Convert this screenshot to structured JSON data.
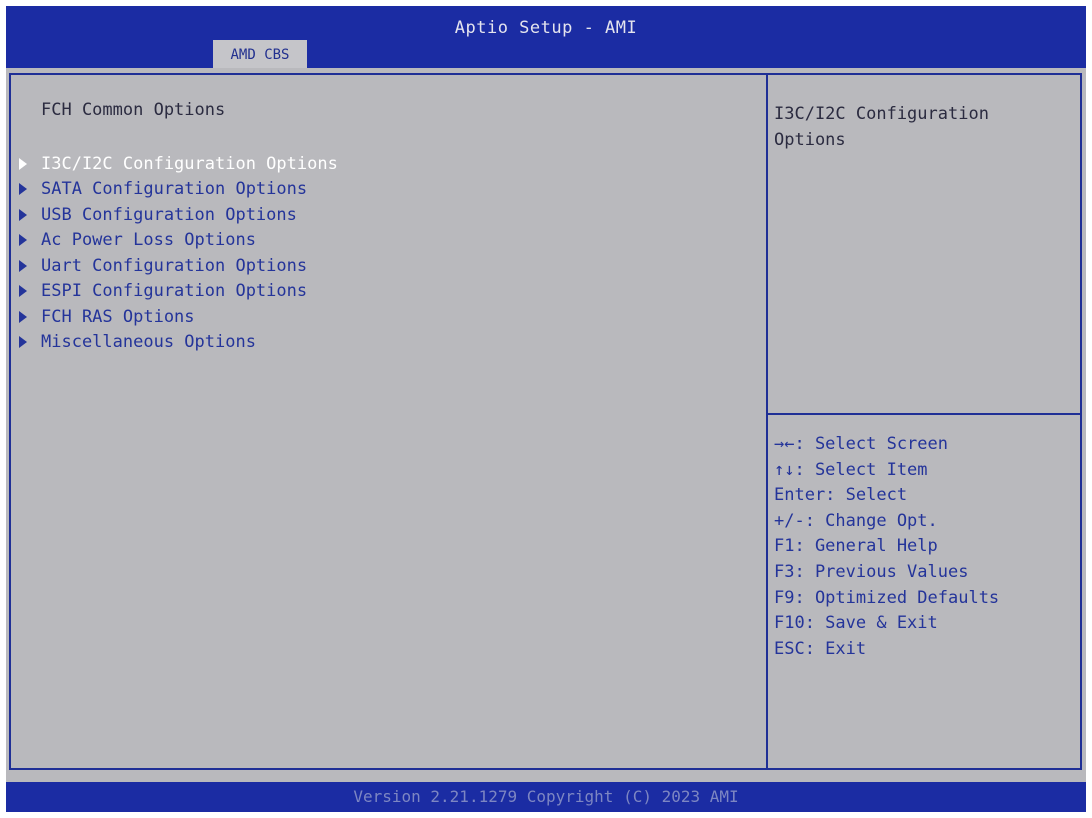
{
  "header": {
    "title": "Aptio Setup - AMI",
    "active_tab": "AMD CBS"
  },
  "colors": {
    "header_bg": "#1b2ca3",
    "panel_bg": "#b9b9bd",
    "menu_text": "#24349a",
    "selected_text": "#ffffff"
  },
  "main": {
    "section_title": "FCH Common Options",
    "items": [
      {
        "label": "I3C/I2C Configuration Options",
        "selected": true
      },
      {
        "label": "SATA Configuration Options",
        "selected": false
      },
      {
        "label": "USB Configuration Options",
        "selected": false
      },
      {
        "label": "Ac Power Loss Options",
        "selected": false
      },
      {
        "label": "Uart Configuration Options",
        "selected": false
      },
      {
        "label": "ESPI Configuration Options",
        "selected": false
      },
      {
        "label": "FCH RAS Options",
        "selected": false
      },
      {
        "label": "Miscellaneous Options",
        "selected": false
      }
    ]
  },
  "help": {
    "description": "I3C/I2C Configuration Options",
    "keys": [
      "→←: Select Screen",
      "↑↓: Select Item",
      "Enter: Select",
      "+/-: Change Opt.",
      "F1: General Help",
      "F3: Previous Values",
      "F9: Optimized Defaults",
      "F10: Save & Exit",
      "ESC: Exit"
    ]
  },
  "footer": {
    "text": "Version 2.21.1279 Copyright (C) 2023 AMI"
  }
}
